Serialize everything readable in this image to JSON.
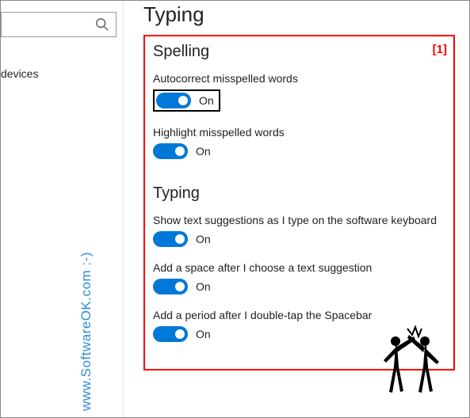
{
  "page_title": "Typing",
  "annotation": "[1]",
  "sidebar": {
    "items": [
      {
        "label": "devices"
      }
    ]
  },
  "sections": {
    "spelling": {
      "heading": "Spelling",
      "settings": [
        {
          "label": "Autocorrect misspelled words",
          "state": "On"
        },
        {
          "label": "Highlight misspelled words",
          "state": "On"
        }
      ]
    },
    "typing": {
      "heading": "Typing",
      "settings": [
        {
          "label": "Show text suggestions as I type on the software keyboard",
          "state": "On"
        },
        {
          "label": "Add a space after I choose a text suggestion",
          "state": "On"
        },
        {
          "label": "Add a period after I double-tap the Spacebar",
          "state": "On"
        }
      ]
    }
  },
  "watermark": "www.SoftwareOK.com :-)"
}
